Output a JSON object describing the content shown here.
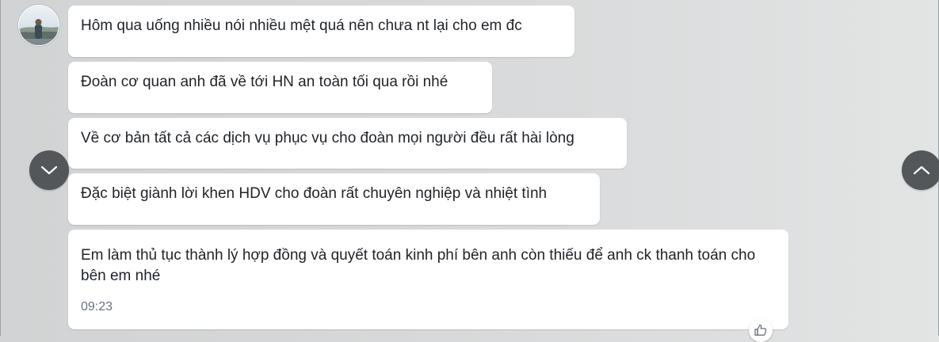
{
  "conversation": {
    "messages": [
      {
        "text": "Hôm qua uống nhiều nói nhiều mệt quá nên chưa nt lại cho em đc"
      },
      {
        "text": "Đoàn cơ quan anh đã về tới HN an toàn tối qua rồi nhé"
      },
      {
        "text": "Về cơ bản tất cả các dịch vụ phục vụ cho đoàn mọi người đều rất hài lòng"
      },
      {
        "text": "Đặc biệt giành lời khen HDV cho đoàn rất chuyên nghiệp và nhiệt tình"
      },
      {
        "text": "Em làm thủ tục thành lý hợp đồng và quyết toán kinh phí bên anh còn thiếu để anh ck thanh toán cho bên em nhé",
        "time": "09:23"
      }
    ]
  },
  "icons": {
    "scroll_left": "chevron-down-icon",
    "scroll_right": "chevron-up-icon",
    "reaction": "thumbs-up-icon"
  },
  "colors": {
    "bubble_bg": "#ffffff",
    "text": "#1f2328",
    "timestamp": "#6b7280",
    "scroll_button": "#53575a"
  }
}
